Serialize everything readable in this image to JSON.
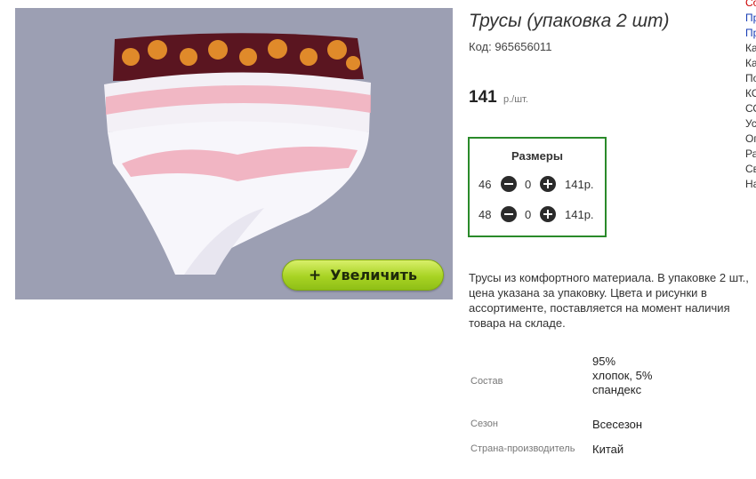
{
  "product": {
    "title": "Трусы (упаковка 2 шт)",
    "code": "Код: 965656011",
    "price": "141",
    "price_unit": "р./шт.",
    "zoom_button": "Увеличить",
    "zoom_icon": "+"
  },
  "sizes": {
    "title": "Размеры",
    "rows": [
      {
        "size": "46",
        "qty": "0",
        "sum": "141р."
      },
      {
        "size": "48",
        "qty": "0",
        "sum": "141р."
      }
    ]
  },
  "description": "Трусы из комфортного материала. В упаковке 2 шт., цена указана за упаковку. Цвета и рисунки в ассортименте, поставляется на момент наличия товара на складе.",
  "properties": [
    {
      "label": "Состав",
      "value": "95% хлопок, 5% спандекс"
    },
    {
      "label": "Сезон",
      "value": "Всесезон"
    },
    {
      "label": "Страна-производитель",
      "value": "Китай"
    }
  ],
  "side_menu": [
    "Со",
    "Пр",
    "Пр",
    "Ка",
    "Ка",
    "По",
    "КО",
    "СО",
    "Ус",
    "Оп",
    "Ра",
    "Св",
    "На"
  ],
  "colors": {
    "accent_green": "#2a8a2a",
    "button_green": "#a8d323",
    "photo_bg": "#9c9fb3"
  }
}
